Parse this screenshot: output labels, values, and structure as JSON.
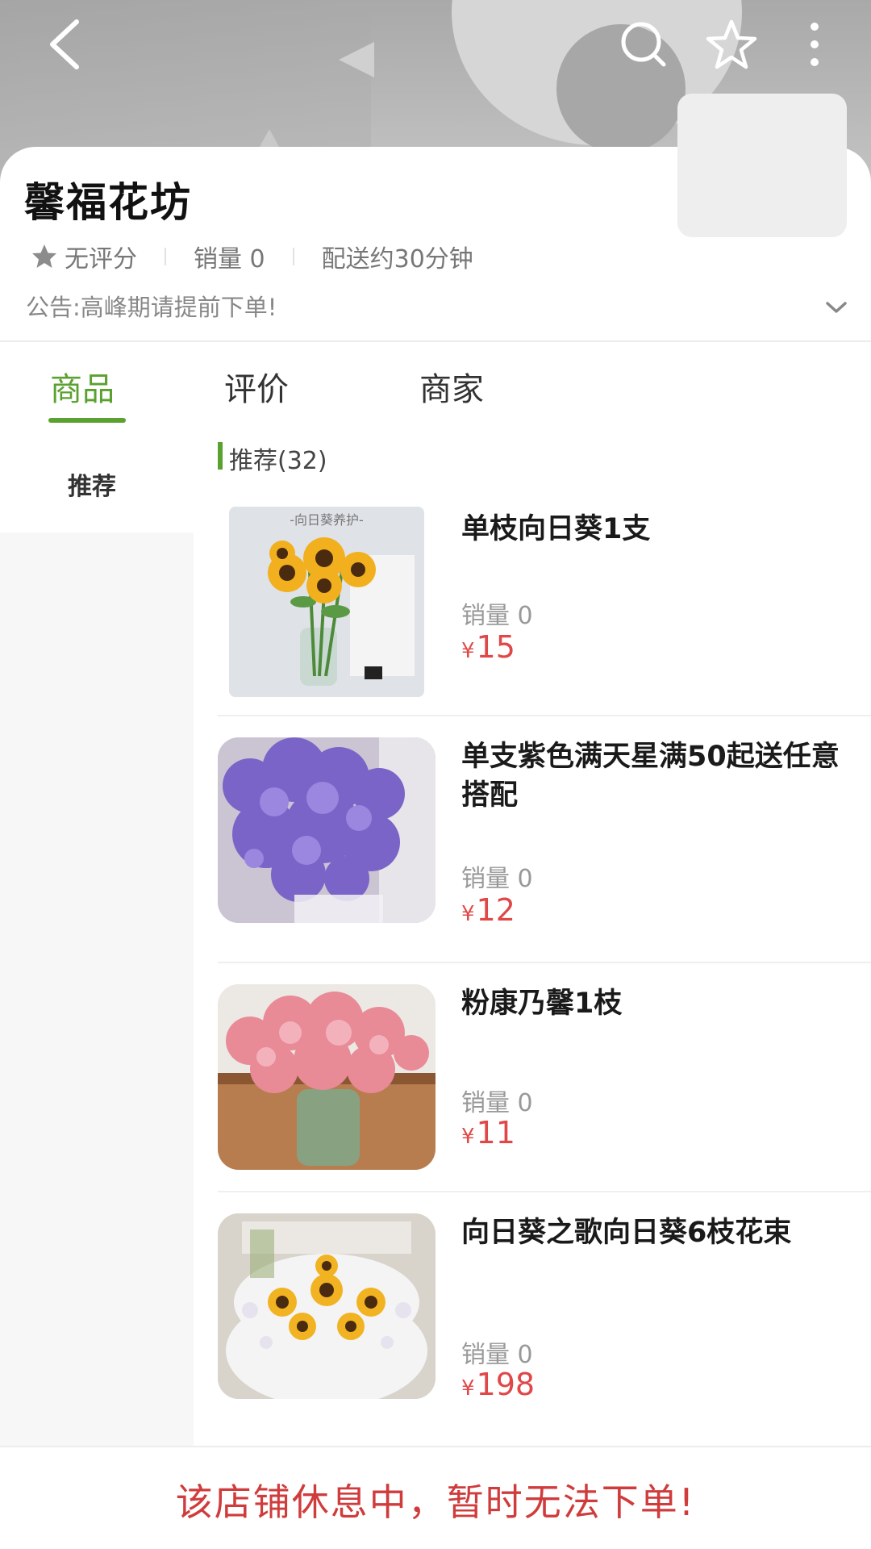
{
  "header": {
    "back_icon": "back-arrow-icon",
    "search_icon": "search-icon",
    "favorite_icon": "star-outline-icon",
    "more_icon": "more-vertical-icon"
  },
  "store": {
    "name": "馨福花坊",
    "rating": "无评分",
    "sales": "销量 0",
    "delivery": "配送约30分钟",
    "notice": "公告:高峰期请提前下单!"
  },
  "tabs": [
    {
      "label": "商品",
      "active": true
    },
    {
      "label": "评价",
      "active": false
    },
    {
      "label": "商家",
      "active": false
    }
  ],
  "categories": [
    {
      "label": "推荐",
      "active": true
    }
  ],
  "section": {
    "title": "推荐(32)"
  },
  "products": [
    {
      "name": "单枝向日葵1支",
      "sales": "销量 0",
      "currency": "¥",
      "price": "15",
      "image_caption": "-向日葵养护-"
    },
    {
      "name": "单支紫色满天星满50起送任意搭配",
      "sales": "销量 0",
      "currency": "¥",
      "price": "12"
    },
    {
      "name": "粉康乃馨1枝",
      "sales": "销量 0",
      "currency": "¥",
      "price": "11"
    },
    {
      "name": "向日葵之歌向日葵6枝花束",
      "sales": "销量 0",
      "currency": "¥",
      "price": "198"
    }
  ],
  "footer": {
    "closed_message": "该店铺休息中，暂时无法下单!"
  },
  "colors": {
    "accent": "#5aa12f",
    "price": "#e04848",
    "closed": "#d03c3c"
  }
}
